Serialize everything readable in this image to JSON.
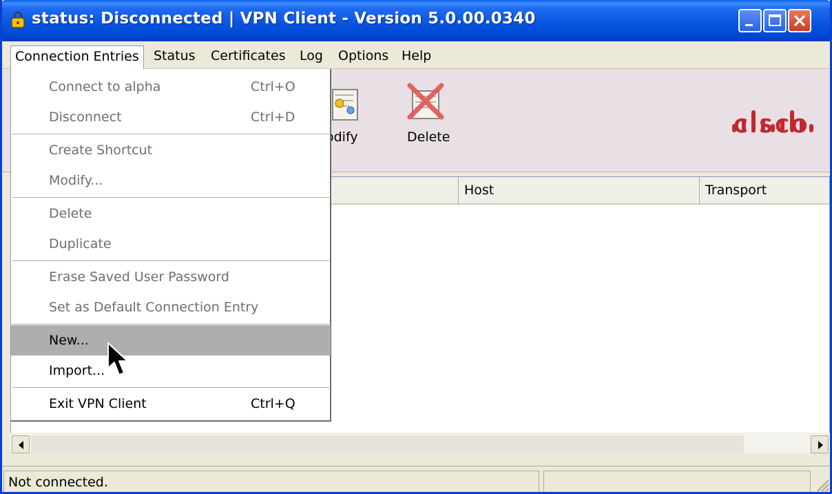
{
  "window": {
    "title": "status: Disconnected | VPN Client - Version 5.0.00.0340",
    "icon": "lock-icon",
    "controls": [
      "minimize-icon",
      "maximize-icon",
      "close-icon"
    ]
  },
  "menubar": {
    "items": [
      "Connection Entries",
      "Status",
      "Certificates",
      "Log",
      "Options",
      "Help"
    ]
  },
  "toolbar": {
    "modify_label": "odify",
    "delete_label": "Delete",
    "logo_text": "CISCO"
  },
  "list": {
    "columns": [
      "Host",
      "Transport"
    ]
  },
  "dropdown": {
    "items": [
      {
        "label": "Connect to alpha",
        "shortcut": "Ctrl+O",
        "enabled": false
      },
      {
        "label": "Disconnect",
        "shortcut": "Ctrl+D",
        "enabled": false
      },
      {
        "label": "Create Shortcut",
        "shortcut": "",
        "enabled": false
      },
      {
        "label": "Modify...",
        "shortcut": "",
        "enabled": false
      },
      {
        "label": "Delete",
        "shortcut": "",
        "enabled": false
      },
      {
        "label": "Duplicate",
        "shortcut": "",
        "enabled": false
      },
      {
        "label": "Erase Saved User Password",
        "shortcut": "",
        "enabled": false
      },
      {
        "label": "Set as Default Connection Entry",
        "shortcut": "",
        "enabled": false
      },
      {
        "label": "New...",
        "shortcut": "",
        "enabled": true,
        "highlighted": true
      },
      {
        "label": "Import...",
        "shortcut": "",
        "enabled": true
      },
      {
        "label": "Exit VPN Client",
        "shortcut": "Ctrl+Q",
        "enabled": true
      }
    ]
  },
  "statusbar": {
    "text": "Not connected.",
    "secondary": ""
  },
  "colors": {
    "titlebar": "#0a56e0",
    "menu_highlight": "#aeaeb0",
    "cisco_red": "#c0292e",
    "disabled_text": "#6e6e6e"
  }
}
